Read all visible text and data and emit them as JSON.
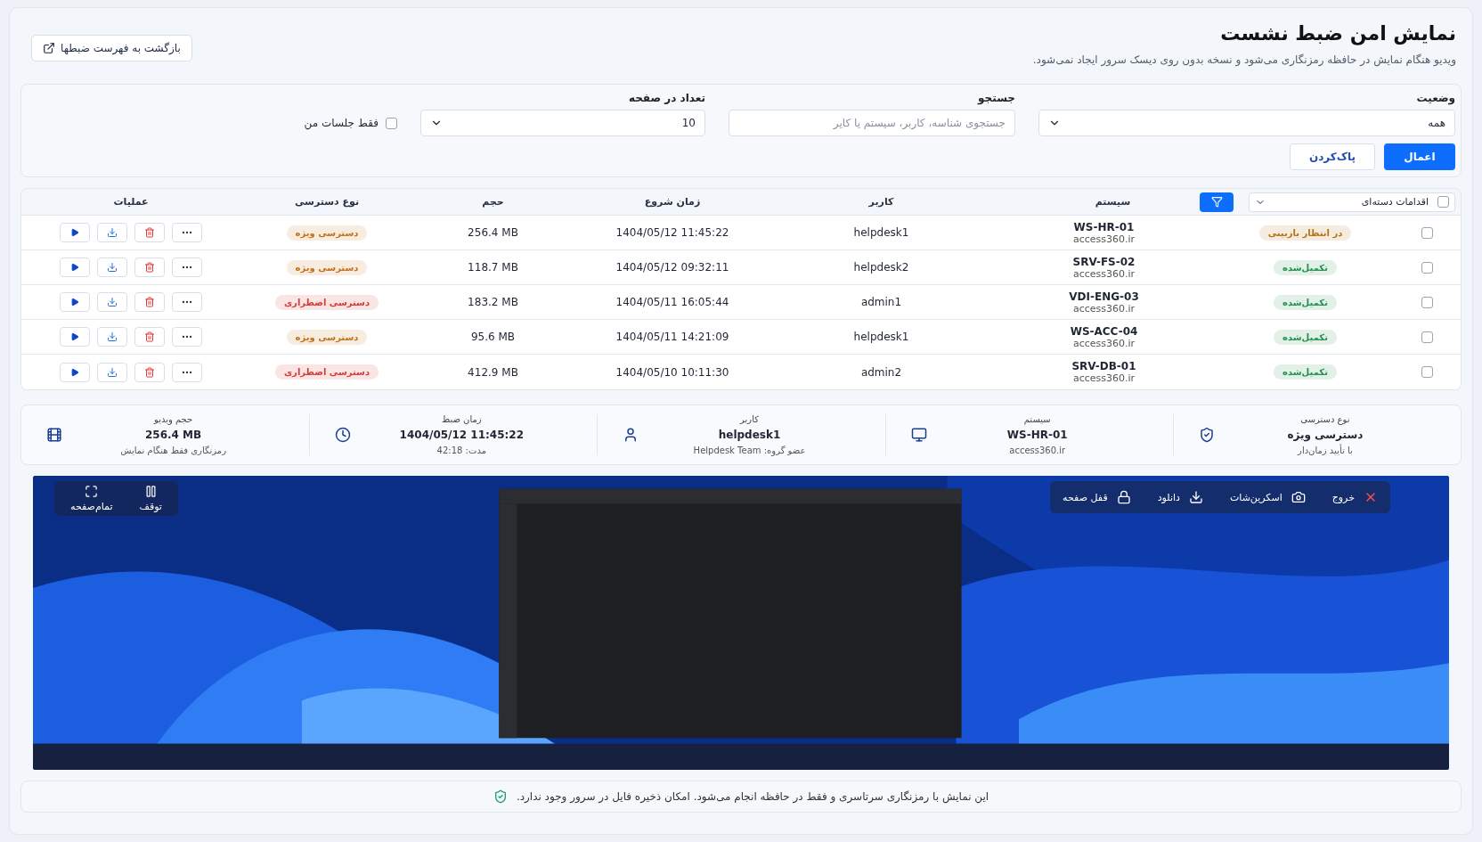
{
  "page": {
    "title": "نمایش امن ضبط نشست",
    "subtitle": "ویدیو هنگام نمایش در حافظه رمزنگاری می‌شود و نسخه بدون روی دیسک سرور ایجاد نمی‌شود.",
    "back_button": "بازگشت به فهرست ضبطها"
  },
  "filters": {
    "status": {
      "label": "وضعیت",
      "value": "همه"
    },
    "search": {
      "label": "جستجو",
      "placeholder": "جستجوی شناسه، کاربر، سیستم یا کایر"
    },
    "page_size": {
      "label": "تعداد در صفحه",
      "value": "10"
    },
    "only_mine": {
      "label": "فقط جلسات من",
      "checked": false
    },
    "apply": "اعمال",
    "clear": "پاک‌کردن"
  },
  "table": {
    "select_all": {
      "checked": false
    },
    "bulk_actions": "اقدامات دسته‌ای",
    "columns": [
      "سیستم",
      "کاربر",
      "زمان شروع",
      "حجم",
      "نوع دسترسی",
      "عملیات"
    ],
    "rows": [
      {
        "checked": false,
        "status": {
          "label": "در انتظار بازبینی",
          "color": "#b5740f"
        },
        "system": "WS-HR-01",
        "domain": "access360.ir",
        "user": "helpdesk1",
        "start": "1404/05/12 11:45:22",
        "size": "256.4 MB",
        "access": {
          "label": "دسترسی ویژه",
          "color": "#c2721a"
        }
      },
      {
        "checked": false,
        "status": {
          "label": "تکمیل‌شده",
          "color": "#23924f"
        },
        "system": "SRV-FS-02",
        "domain": "access360.ir",
        "user": "helpdesk2",
        "start": "1404/05/12 09:32:11",
        "size": "118.7 MB",
        "access": {
          "label": "دسترسی ویژه",
          "color": "#c2721a"
        }
      },
      {
        "checked": false,
        "status": {
          "label": "تکمیل‌شده",
          "color": "#23924f"
        },
        "system": "VDI-ENG-03",
        "domain": "access360.ir",
        "user": "admin1",
        "start": "1404/05/11 16:05:44",
        "size": "183.2 MB",
        "access": {
          "label": "دسترسی اضطراری",
          "color": "#d63c3c"
        }
      },
      {
        "checked": false,
        "status": {
          "label": "تکمیل‌شده",
          "color": "#23924f"
        },
        "system": "WS-ACC-04",
        "domain": "access360.ir",
        "user": "helpdesk1",
        "start": "1404/05/11 14:21:09",
        "size": "95.6 MB",
        "access": {
          "label": "دسترسی ویژه",
          "color": "#c2721a"
        }
      },
      {
        "checked": false,
        "status": {
          "label": "تکمیل‌شده",
          "color": "#23924f"
        },
        "system": "SRV-DB-01",
        "domain": "access360.ir",
        "user": "admin2",
        "start": "1404/05/10 10:11:30",
        "size": "412.9 MB",
        "access": {
          "label": "دسترسی اضطراری",
          "color": "#d63c3c"
        }
      }
    ]
  },
  "details": [
    {
      "kind": "access",
      "label": "نوع دسترسی",
      "value": "دسترسی ویژه",
      "note": "با تأیید زمان‌دار"
    },
    {
      "kind": "system",
      "label": "سیستم",
      "value": "WS-HR-01",
      "note": "access360.ir"
    },
    {
      "kind": "user",
      "label": "کاربر",
      "value": "helpdesk1",
      "note": "عضو گروه: Helpdesk Team"
    },
    {
      "kind": "time",
      "label": "زمان ضبط",
      "value": "1404/05/12 11:45:22",
      "note": "مدت: 42:18"
    },
    {
      "kind": "size",
      "label": "حجم ویدیو",
      "value": "256.4 MB",
      "note": "رمزنگاری فقط هنگام نمایش"
    }
  ],
  "player": {
    "kind": "picture",
    "right_controls": [
      {
        "kind": "exit",
        "label": "خروج"
      },
      {
        "kind": "screenshot",
        "label": "اسکرین‌شات"
      },
      {
        "kind": "download",
        "label": "دانلود"
      },
      {
        "kind": "lock",
        "label": "قفل صفحه"
      }
    ],
    "left_controls": [
      {
        "kind": "pause",
        "label": "توقف"
      },
      {
        "kind": "fullscreen",
        "label": "تمام‌صفحه"
      }
    ]
  },
  "footer_note": "این نمایش با رمزنگاری سرتاسری و فقط در حافظه انجام می‌شود. امکان ذخیره فایل در سرور وجود ندارد."
}
